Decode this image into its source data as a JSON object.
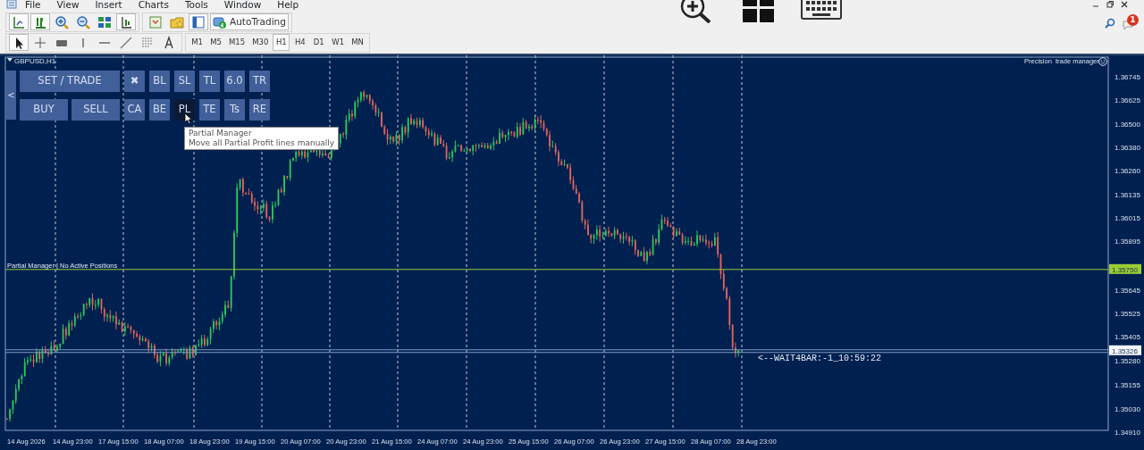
{
  "menu": [
    "File",
    "View",
    "Insert",
    "Charts",
    "Tools",
    "Window",
    "Help"
  ],
  "toolbar": {
    "autotrading": "AutoTrading"
  },
  "drawing_tools": [
    {
      "selected": true
    },
    {
      "selected": false
    },
    {
      "selected": false
    },
    {
      "selected": false
    },
    {
      "selected": false
    },
    {
      "selected": false
    },
    {
      "selected": false
    },
    {
      "selected": false
    }
  ],
  "timeframes": [
    {
      "label": "M1",
      "selected": false
    },
    {
      "label": "M5",
      "selected": false
    },
    {
      "label": "M15",
      "selected": false
    },
    {
      "label": "M30",
      "selected": false
    },
    {
      "label": "H1",
      "selected": true
    },
    {
      "label": "H4",
      "selected": false
    },
    {
      "label": "D1",
      "selected": false
    },
    {
      "label": "W1",
      "selected": false
    },
    {
      "label": "MN",
      "selected": false
    }
  ],
  "notification_badge": "1",
  "chart": {
    "symbol": "GBPUSD,H1",
    "indicator_name": "Precision  trade manager",
    "status_text": "Partial Manager | No Active Positions",
    "timer_text": "<--WAIT4BAR:-1_10:59:22",
    "panel": {
      "collapse": "<",
      "main_buttons": [
        {
          "label": "SET / TRADE",
          "kind": "wide",
          "selected": false
        },
        {
          "label": "BUY",
          "kind": "half",
          "selected": false
        },
        {
          "label": "SELL",
          "kind": "half",
          "selected": false
        }
      ],
      "rows": [
        [
          {
            "label": "✖",
            "selected": false
          },
          {
            "label": "BL",
            "selected": false
          },
          {
            "label": "SL",
            "selected": false
          },
          {
            "label": "TL",
            "selected": false
          },
          {
            "label": "6.0",
            "selected": false
          },
          {
            "label": "TR",
            "selected": false
          }
        ],
        [
          {
            "label": "CA",
            "selected": false
          },
          {
            "label": "BE",
            "selected": false
          },
          {
            "label": "PL",
            "selected": true
          },
          {
            "label": "TE",
            "selected": false
          },
          {
            "label": "Ts",
            "selected": false
          },
          {
            "label": "RE",
            "selected": false
          }
        ]
      ]
    },
    "tooltip": {
      "title": "Partial Manager",
      "text": "Move all Partial Profit lines manually"
    },
    "price_axis": [
      "1.36745",
      "1.36625",
      "1.36500",
      "1.36380",
      "1.36260",
      "1.36135",
      "1.36015",
      "1.35895",
      "1.35645",
      "1.35525",
      "1.35405",
      "1.35280",
      "1.35155",
      "1.35030",
      "1.34910"
    ],
    "price_line": {
      "label": "1.35750",
      "color": "#9acd32"
    },
    "bid_line": {
      "label": "1.35326"
    },
    "time_axis": [
      "14 Aug 2026",
      "14 Aug 23:00",
      "17 Aug 15:00",
      "18 Aug 07:00",
      "18 Aug 23:00",
      "19 Aug 15:00",
      "20 Aug 07:00",
      "20 Aug 23:00",
      "21 Aug 15:00",
      "24 Aug 07:00",
      "24 Aug 23:00",
      "25 Aug 15:00",
      "26 Aug 07:00",
      "26 Aug 23:00",
      "27 Aug 15:00",
      "28 Aug 07:00",
      "28 Aug 23:00"
    ]
  }
}
